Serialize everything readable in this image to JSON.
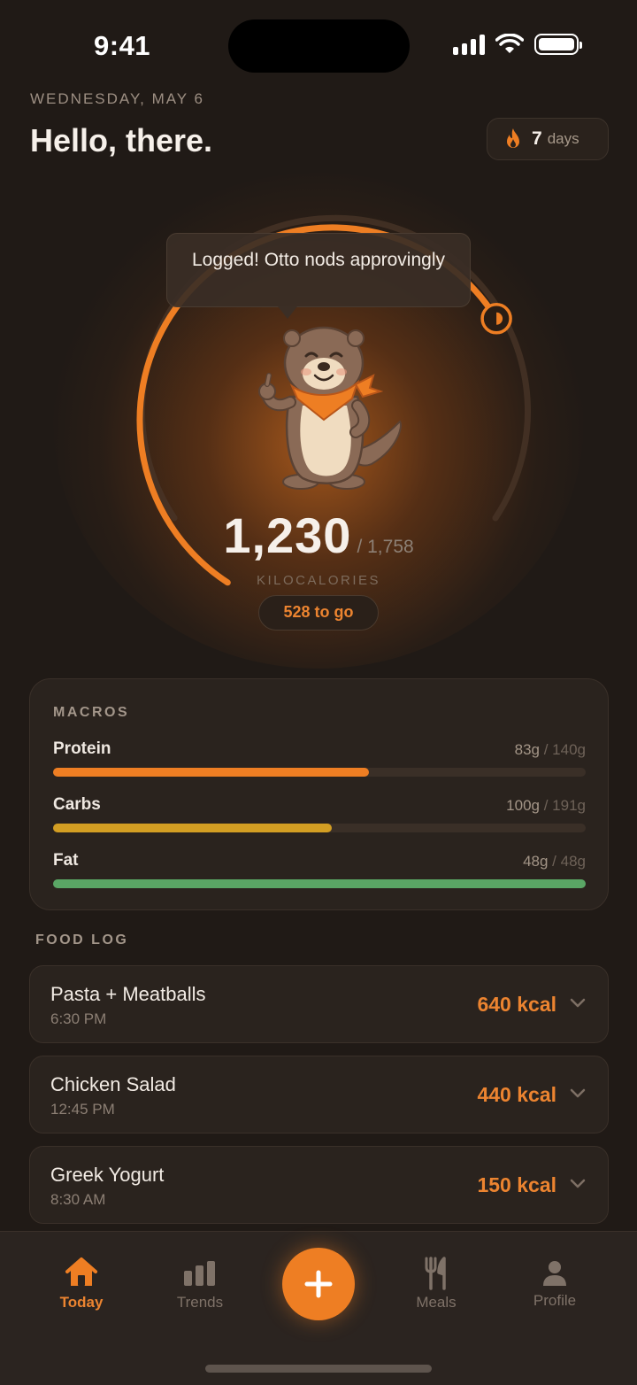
{
  "status": {
    "time": "9:41"
  },
  "header": {
    "date": "WEDNESDAY, MAY 6",
    "greeting": "Hello, there."
  },
  "streak": {
    "count": "7",
    "unit": "days",
    "icon": "flame-icon"
  },
  "hero": {
    "bubble_text": "Logged! Otto nods approvingly",
    "calories_consumed": "1,230",
    "calories_goal": "/ 1,758",
    "unit_label": "KILOCALORIES",
    "remaining": "528 to go",
    "progress_fraction": 0.7
  },
  "macros": {
    "title": "MACROS",
    "items": [
      {
        "name": "Protein",
        "value": "83g",
        "goal": " / 140g",
        "fraction": 0.593,
        "color": "#ee7e23"
      },
      {
        "name": "Carbs",
        "value": "100g",
        "goal": " / 191g",
        "fraction": 0.524,
        "color": "#d39e23"
      },
      {
        "name": "Fat",
        "value": "48g",
        "goal": " / 48g",
        "fraction": 1.0,
        "color": "#5aa665"
      }
    ]
  },
  "food_log": {
    "title": "FOOD LOG",
    "items": [
      {
        "name": "Pasta + Meatballs",
        "time": "6:30 PM",
        "kcal": "640 kcal"
      },
      {
        "name": "Chicken Salad",
        "time": "12:45 PM",
        "kcal": "440 kcal"
      },
      {
        "name": "Greek Yogurt",
        "time": "8:30 AM",
        "kcal": "150 kcal"
      }
    ]
  },
  "tabs": [
    {
      "label": "Today",
      "icon": "home-icon",
      "active": true
    },
    {
      "label": "Trends",
      "icon": "bar-chart-icon",
      "active": false
    },
    {
      "label": "Meals",
      "icon": "utensils-icon",
      "active": false
    },
    {
      "label": "Profile",
      "icon": "person-icon",
      "active": false
    }
  ],
  "colors": {
    "accent": "#ee7e23",
    "background": "#201a16",
    "card": "#2a231e"
  }
}
